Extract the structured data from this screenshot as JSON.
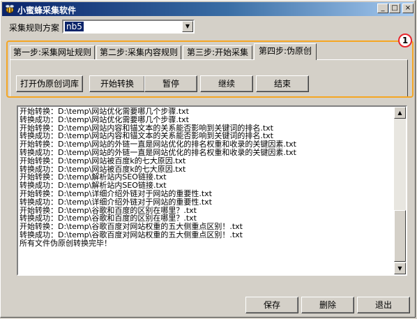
{
  "window": {
    "title": "小蜜蜂采集软件",
    "controls": {
      "minimize": "_",
      "maximize": "□",
      "close": "×"
    }
  },
  "scheme": {
    "label": "采集规则方案",
    "value": "nb5"
  },
  "tabs": [
    {
      "label": "第一步:采集网址规则"
    },
    {
      "label": "第二步:采集内容规则"
    },
    {
      "label": "第三步:开始采集"
    },
    {
      "label": "第四步:伪原创"
    }
  ],
  "active_tab": 3,
  "actions": {
    "open_lib": "打开伪原创词库",
    "start": "开始转换",
    "pause": "暂停",
    "continue": "继续",
    "end": "结束"
  },
  "annotation": {
    "number": "1",
    "color": "#f5a623"
  },
  "log": [
    "开始转换：D:\\temp\\网站优化需要哪几个步骤.txt",
    "转换成功：D:\\temp\\网站优化需要哪几个步骤.txt",
    "开始转换：D:\\temp\\网站内容和锚文本的关系能否影响到关键词的排名.txt",
    "转换成功：D:\\temp\\网站内容和锚文本的关系能否影响到关键词的排名.txt",
    "开始转换：D:\\temp\\网站的外链一直是网站优化的排名权重和收录的关键因素.txt",
    "转换成功：D:\\temp\\网站的外链一直是网站优化的排名权重和收录的关键因素.txt",
    "开始转换：D:\\temp\\网站被百度k的七大原因.txt",
    "转换成功：D:\\temp\\网站被百度k的七大原因.txt",
    "开始转换：D:\\temp\\解析站内SEO链接.txt",
    "转换成功：D:\\temp\\解析站内SEO链接.txt",
    "开始转换：D:\\temp\\详细介绍外链对于网站的重要性.txt",
    "转换成功：D:\\temp\\详细介绍外链对于网站的重要性.txt",
    "开始转换：D:\\temp\\谷歌和百度的区别在哪里？.txt",
    "转换成功：D:\\temp\\谷歌和百度的区别在哪里？.txt",
    "开始转换：D:\\temp\\谷歌百度对网站权重的五大侧重点区别！.txt",
    "转换成功：D:\\temp\\谷歌百度对网站权重的五大侧重点区别！.txt",
    "所有文件伪原创转换完毕！"
  ],
  "footer": {
    "save": "保存",
    "delete": "删除",
    "exit": "退出"
  }
}
